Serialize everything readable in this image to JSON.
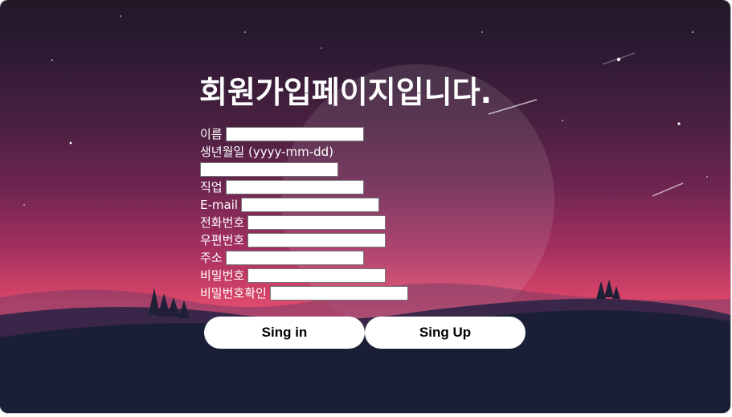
{
  "page": {
    "title": "회원가입페이지입니다."
  },
  "form": {
    "fields": [
      {
        "label": "이름",
        "value": ""
      },
      {
        "label": "생년월일 (yyyy-mm-dd)",
        "value": ""
      },
      {
        "label": "직업",
        "value": ""
      },
      {
        "label": "E-mail",
        "value": ""
      },
      {
        "label": "전화번호",
        "value": ""
      },
      {
        "label": "우편번호",
        "value": ""
      },
      {
        "label": "주소",
        "value": ""
      },
      {
        "label": "비밀번호",
        "value": ""
      },
      {
        "label": "비밀번호확인",
        "value": ""
      }
    ]
  },
  "buttons": {
    "signin_label": "Sing in",
    "signup_label": "Sing Up"
  },
  "colors": {
    "sky_top": "#211827",
    "sky_glow": "#e9587a",
    "ground": "#1a1f36",
    "text": "#ffffff",
    "button_bg": "#ffffff"
  }
}
